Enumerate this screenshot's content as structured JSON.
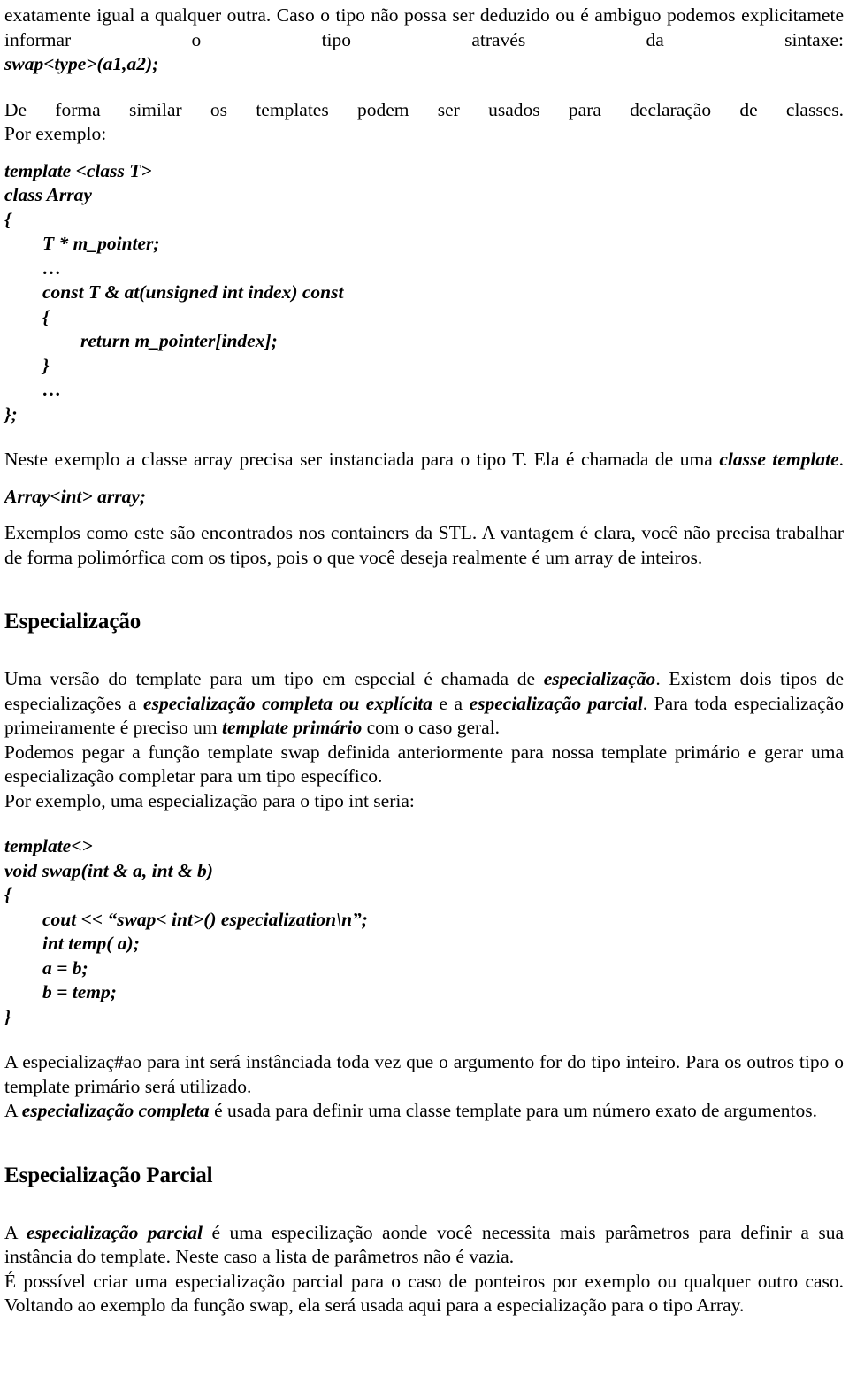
{
  "document": {
    "language": "pt-BR",
    "body_font_size_px": 21.5,
    "text_color": "#000000",
    "background_color": "#ffffff"
  },
  "intro": {
    "para1_part1": "exatamente igual a qualquer outra. Caso o tipo não possa ser deduzido ou é ambiguo podemos explicitamete informar o tipo através da sintaxe:",
    "code_inline_swap": "swap<type>(a1,a2);",
    "para2": "De forma similar os templates podem ser usados para declaração de classes.",
    "para2_tail": "Por exemplo:"
  },
  "code_block_array": {
    "lines": [
      "template <class T>",
      "class Array",
      "{",
      "        T * m_pointer;",
      "        …",
      "        const T & at(unsigned int index) const",
      "        {",
      "                return m_pointer[index];",
      "        }",
      "        …",
      "};"
    ]
  },
  "after_array": {
    "para_lead": "Neste exemplo a classe array precisa ser instanciada para o tipo T. Ela é chamada de uma ",
    "para_emph": "classe template",
    "para_tail": ".",
    "code_inline_instance": "Array<int> array;",
    "para_stl": "Exemplos como este são encontrados nos containers da STL. A vantagem é clara, você não precisa trabalhar de forma polimórfica  com os tipos,  pois o que você deseja realmente é um array de inteiros."
  },
  "section_especializacao": {
    "heading": "Especialização",
    "p1_a": "Uma versão do template para um tipo em especial é chamada de  ",
    "p1_em1": "especialização",
    "p1_b": ". Existem dois tipos de especializações a ",
    "p1_em2": "especialização completa ou explícita",
    "p1_c": " e a ",
    "p1_em3": "especialização parcial",
    "p1_d": ". Para toda especialização primeiramente é preciso um ",
    "p1_em4": "template primário",
    "p1_e": " com o caso geral.",
    "p2": "Podemos pegar a função template swap definida anteriormente para nossa template primário e gerar uma especialização completar para um tipo específico.",
    "p3": "Por exemplo, uma especialização para o tipo int seria:"
  },
  "code_block_swap": {
    "lines": [
      "template<>",
      "void swap(int & a, int & b)",
      "{",
      "        cout << “swap< int>() especialization\\n”;",
      "        int temp( a);",
      "        a = b;",
      "        b = temp;",
      "}"
    ]
  },
  "after_swap": {
    "p1": "A especializaç#ao para int será instânciada toda vez que o argumento for do tipo inteiro. Para os outros tipo o template primário será utilizado.",
    "p2_a": "A ",
    "p2_em": "especialização completa",
    "p2_b": " é usada para definir uma classe template para um número exato de argumentos."
  },
  "section_parcial": {
    "heading": "Especialização Parcial",
    "p1_a": "A ",
    "p1_em": "especialização parcial",
    "p1_b": " é uma especilização aonde você necessita mais parâmetros para definir a sua instância do template. Neste caso a lista de parâmetros não é vazia.",
    "p2": "É possível criar uma especialização parcial para o caso de ponteiros por exemplo ou qualquer outro caso. Voltando ao exemplo da função swap, ela será usada aqui para a especialização para o tipo Array."
  }
}
